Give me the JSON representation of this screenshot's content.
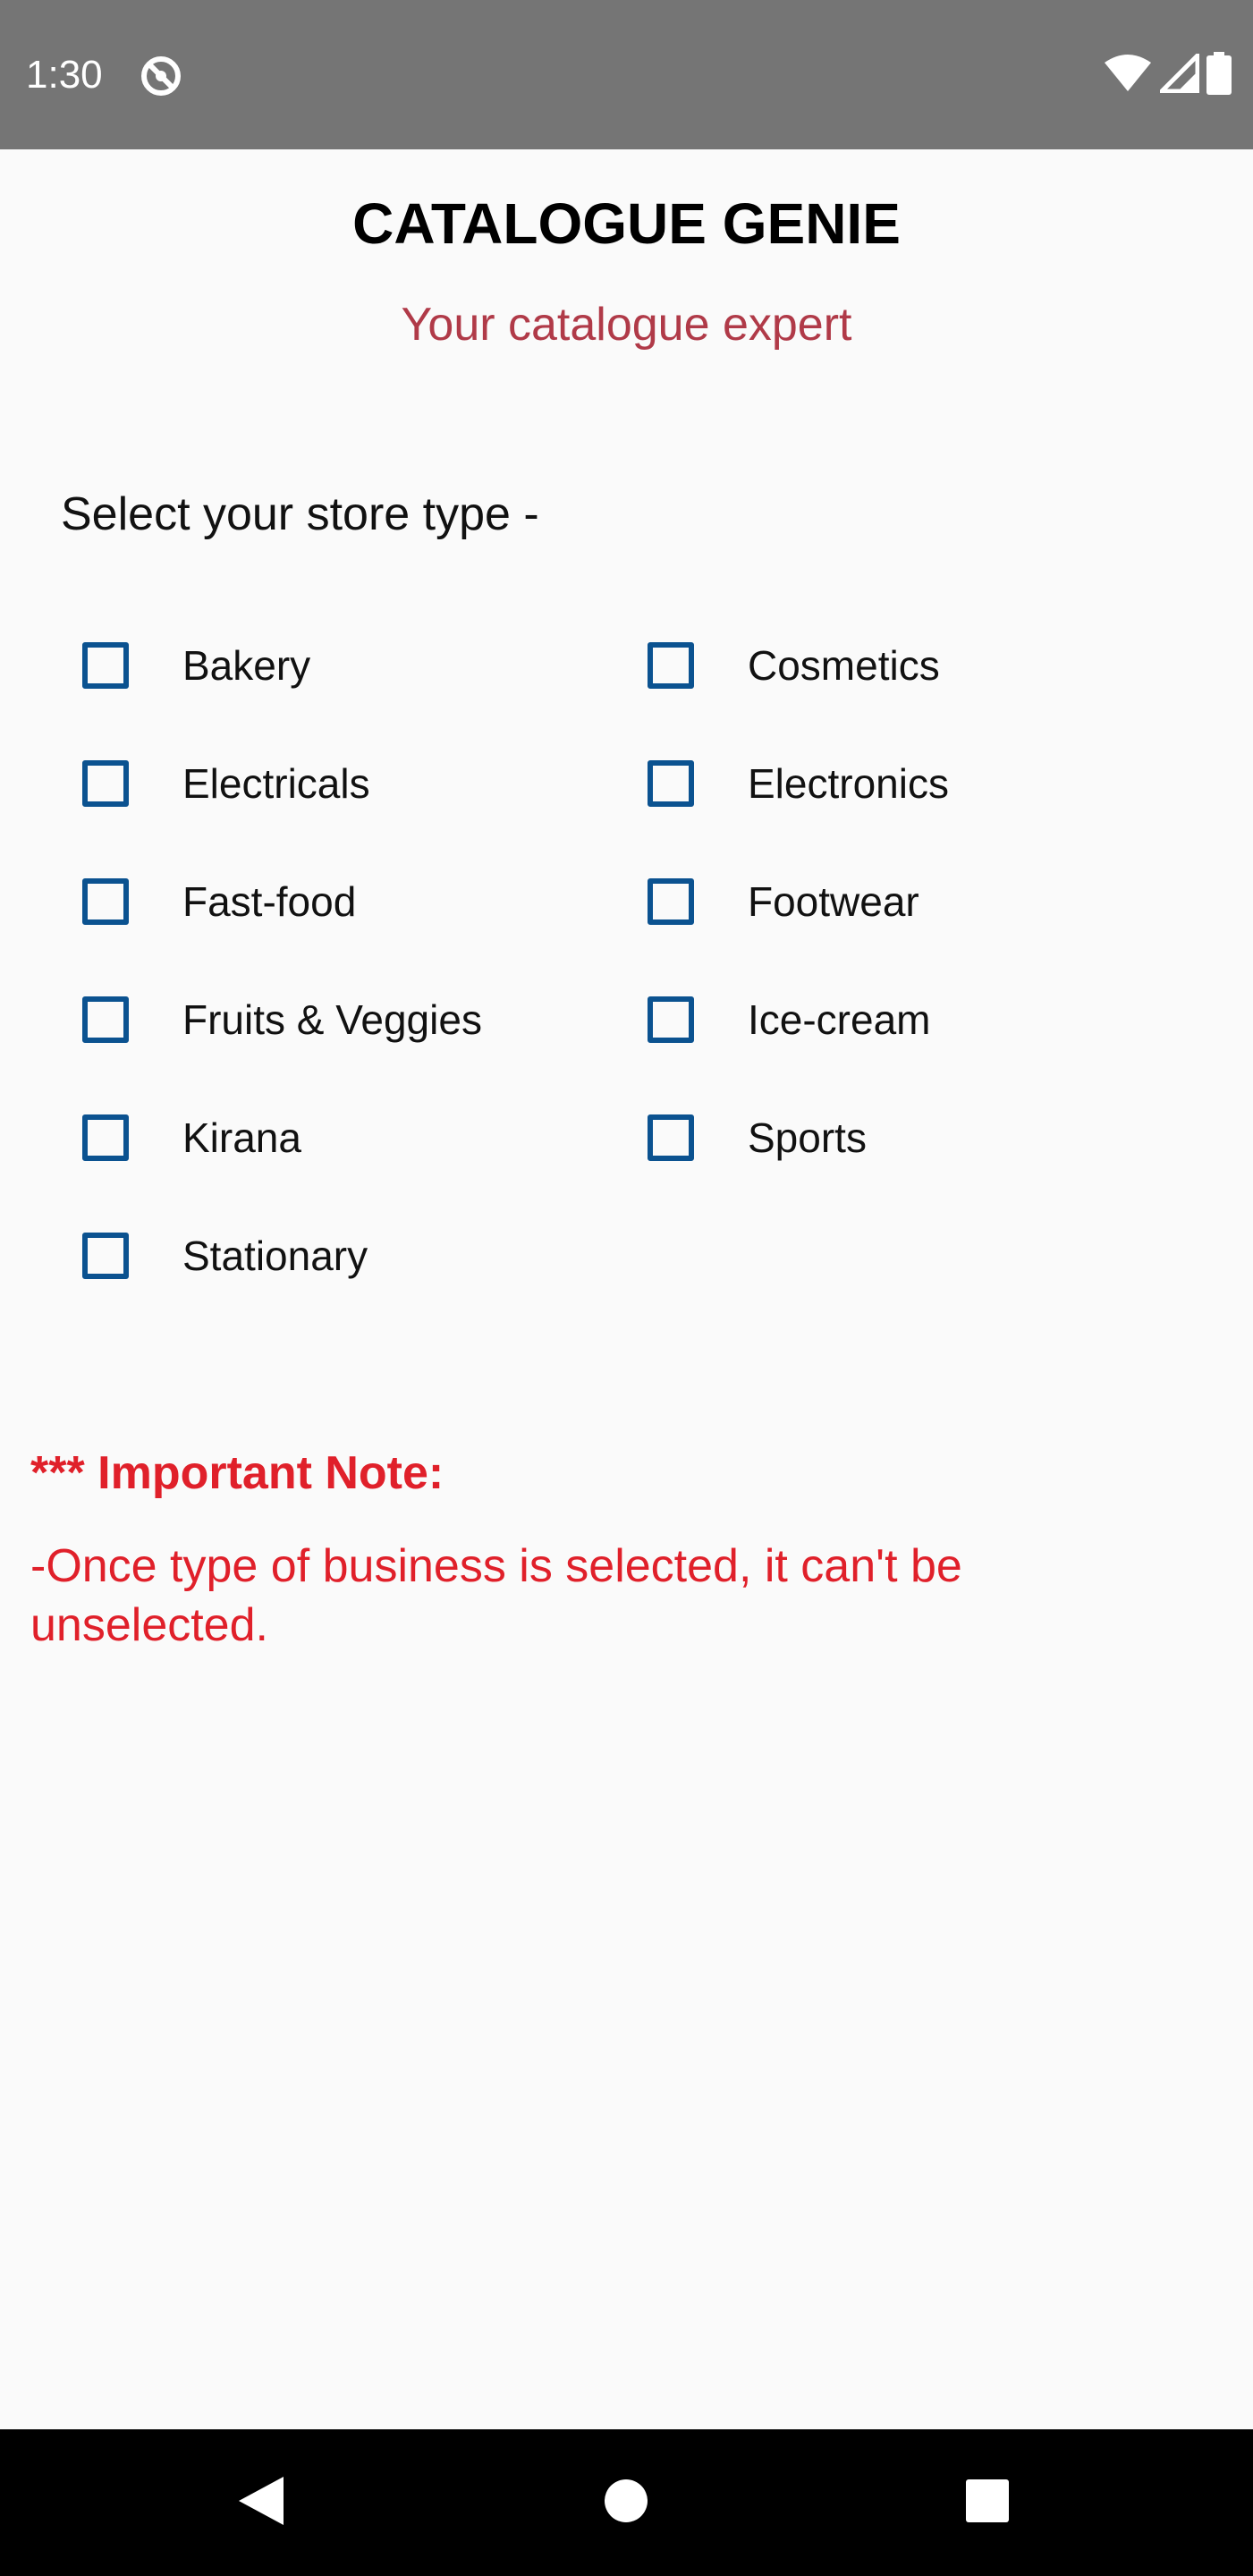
{
  "status_bar": {
    "time": "1:30",
    "icons": [
      "app-notification-icon",
      "wifi-icon",
      "cellular-signal-icon",
      "battery-icon"
    ]
  },
  "header": {
    "title": "CATALOGUE GENIE",
    "subtitle": "Your catalogue expert"
  },
  "store_selection": {
    "label": "Select your store type -",
    "options": [
      {
        "label": "Bakery",
        "checked": false
      },
      {
        "label": "Cosmetics",
        "checked": false
      },
      {
        "label": "Electricals",
        "checked": false
      },
      {
        "label": "Electronics",
        "checked": false
      },
      {
        "label": "Fast-food",
        "checked": false
      },
      {
        "label": "Footwear",
        "checked": false
      },
      {
        "label": "Fruits & Veggies",
        "checked": false
      },
      {
        "label": "Ice-cream",
        "checked": false
      },
      {
        "label": "Kirana",
        "checked": false
      },
      {
        "label": "Sports",
        "checked": false
      },
      {
        "label": "Stationary",
        "checked": false
      }
    ]
  },
  "note": {
    "title": "*** Important Note:",
    "body": "-Once type of business is selected, it can't be unselected."
  },
  "nav_bar": {
    "buttons": [
      "back-icon",
      "home-icon",
      "recents-icon"
    ]
  },
  "colors": {
    "status_bar": "#757575",
    "background": "#fafafa",
    "subtitle": "#b03a48",
    "checkbox": "#0b5290",
    "note": "#e0202a"
  }
}
